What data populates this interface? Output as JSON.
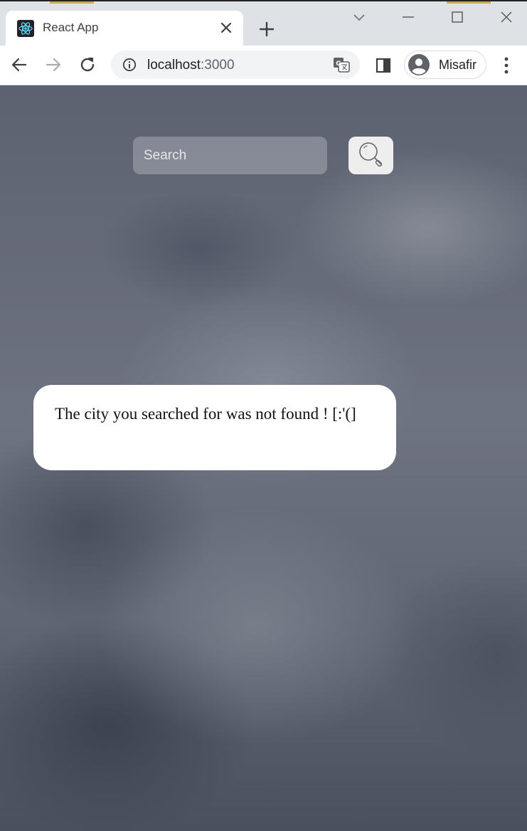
{
  "browser": {
    "tab": {
      "title": "React App",
      "favicon": "react-logo-icon"
    },
    "address_bar": {
      "host": "localhost",
      "port": ":3000"
    },
    "profile": {
      "name": "Misafir"
    },
    "colors": {
      "tab_strip": "#dee1e6",
      "toolbar": "#ffffff",
      "favicon_bg": "#20232a",
      "react_cyan": "#61dafb"
    }
  },
  "search": {
    "placeholder": "Search",
    "value": "",
    "button_icon": "magnifier-icon"
  },
  "result": {
    "message": "The city you searched for was not found ! [:'(]"
  },
  "page": {
    "background": "stormy-cloud-sky",
    "colors": {
      "card_bg": "#ffffff",
      "button_bg": "#eeeeee"
    }
  }
}
